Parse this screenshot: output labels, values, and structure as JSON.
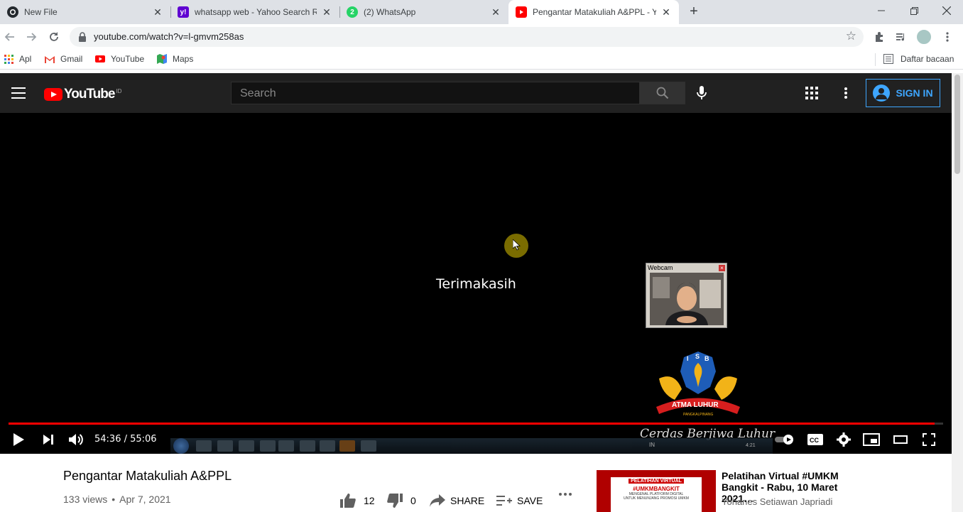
{
  "browser": {
    "tabs": [
      {
        "title": "New File",
        "icon": "github-icon"
      },
      {
        "title": "whatsapp web - Yahoo Search Re",
        "icon": "yahoo-icon"
      },
      {
        "title": "(2) WhatsApp",
        "icon": "whatsapp-icon",
        "badge": "2"
      },
      {
        "title": "Pengantar Matakuliah A&PPL - Y",
        "icon": "youtube-icon",
        "active": true
      }
    ],
    "url": "youtube.com/watch?v=l-gmvm258as",
    "bookmarks": [
      {
        "label": "Apl",
        "icon": "apps-grid-icon"
      },
      {
        "label": "Gmail",
        "icon": "gmail-icon"
      },
      {
        "label": "YouTube",
        "icon": "youtube-icon"
      },
      {
        "label": "Maps",
        "icon": "maps-icon"
      }
    ],
    "reading_list": "Daftar bacaan"
  },
  "youtube": {
    "logo_text": "YouTube",
    "logo_country": "ID",
    "search_placeholder": "Search",
    "sign_in": "SIGN IN"
  },
  "player": {
    "slide_text": "Terimakasih",
    "webcam_title": "Webcam",
    "logo_top_text": "ISB",
    "logo_ribbon": "ATMA LUHUR",
    "logo_sub": "PANGKALPINANG",
    "motto": "Cerdas Berjiwa Luhur",
    "time": "54:36 / 55:06",
    "progress": 0.991,
    "taskbar_lang": "IN",
    "taskbar_clock": "4:21"
  },
  "video": {
    "title": "Pengantar Matakuliah A&PPL",
    "views": "133 views",
    "date": "Apr 7, 2021",
    "likes": "12",
    "dislikes": "0",
    "share": "SHARE",
    "save": "SAVE"
  },
  "recommended": {
    "title": "Pelatihan Virtual #UMKM Bangkit - Rabu, 10 Maret 2021…",
    "channel": "Yohanes Setiawan Japriadi",
    "thumb_lines": [
      "PELATIHAN VIRTUAL",
      "#UMKMBANGKIT",
      "MENGENAL PLATFORM DIGITAL",
      "UNTUK MENUNJANG PROMOSI UMKM"
    ]
  }
}
